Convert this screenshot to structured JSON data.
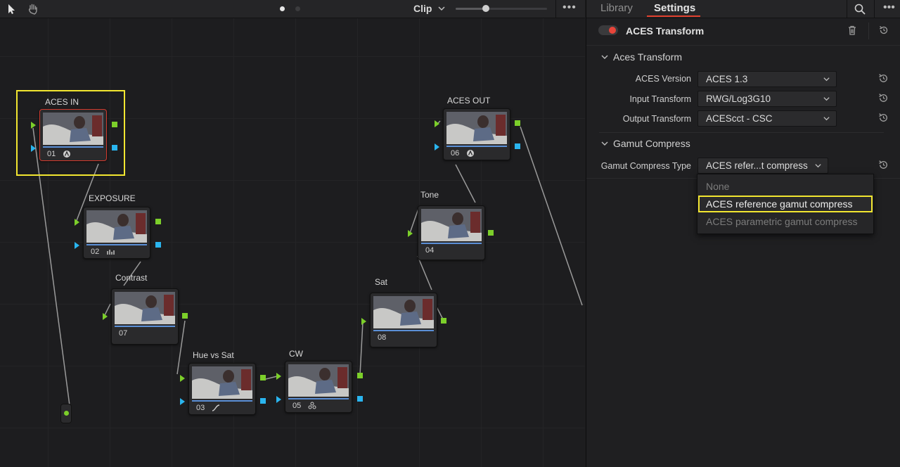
{
  "editor": {
    "toolbar": {
      "clip_label": "Clip",
      "zoom_level": 0.33
    },
    "nodes": [
      {
        "id": "n01",
        "label": "ACES IN",
        "number": "01",
        "icon": "aces-icon"
      },
      {
        "id": "n02",
        "label": "EXPOSURE",
        "number": "02",
        "icon": "bars-icon"
      },
      {
        "id": "n07",
        "label": "Contrast",
        "number": "07",
        "icon": ""
      },
      {
        "id": "n03",
        "label": "Hue vs Sat",
        "number": "03",
        "icon": "curve-icon"
      },
      {
        "id": "n05",
        "label": "CW",
        "number": "05",
        "icon": "wheels-icon"
      },
      {
        "id": "n08",
        "label": "Sat",
        "number": "08",
        "icon": ""
      },
      {
        "id": "n04",
        "label": "Tone",
        "number": "04",
        "icon": ""
      },
      {
        "id": "n06",
        "label": "ACES OUT",
        "number": "06",
        "icon": "aces-icon"
      }
    ]
  },
  "panel": {
    "tabs": {
      "library": "Library",
      "settings": "Settings"
    },
    "effect": {
      "title": "ACES Transform",
      "enabled": true
    },
    "sections": {
      "aces": {
        "title": "Aces Transform",
        "rows": [
          {
            "label": "ACES Version",
            "value": "ACES 1.3"
          },
          {
            "label": "Input Transform",
            "value": "RWG/Log3G10"
          },
          {
            "label": "Output Transform",
            "value": "ACEScct - CSC"
          }
        ]
      },
      "gamut": {
        "title": "Gamut Compress",
        "row": {
          "label": "Gamut Compress Type",
          "value": "ACES refer...t compress"
        },
        "dropdown": {
          "options": [
            "None",
            "ACES reference gamut compress",
            "ACES parametric gamut compress"
          ],
          "highlighted": "ACES reference gamut compress"
        }
      }
    }
  },
  "colors": {
    "accent_red": "#e8453a",
    "highlight_yellow": "#f2e630",
    "port_green": "#7ccf2a",
    "port_blue": "#2ab5ef"
  }
}
